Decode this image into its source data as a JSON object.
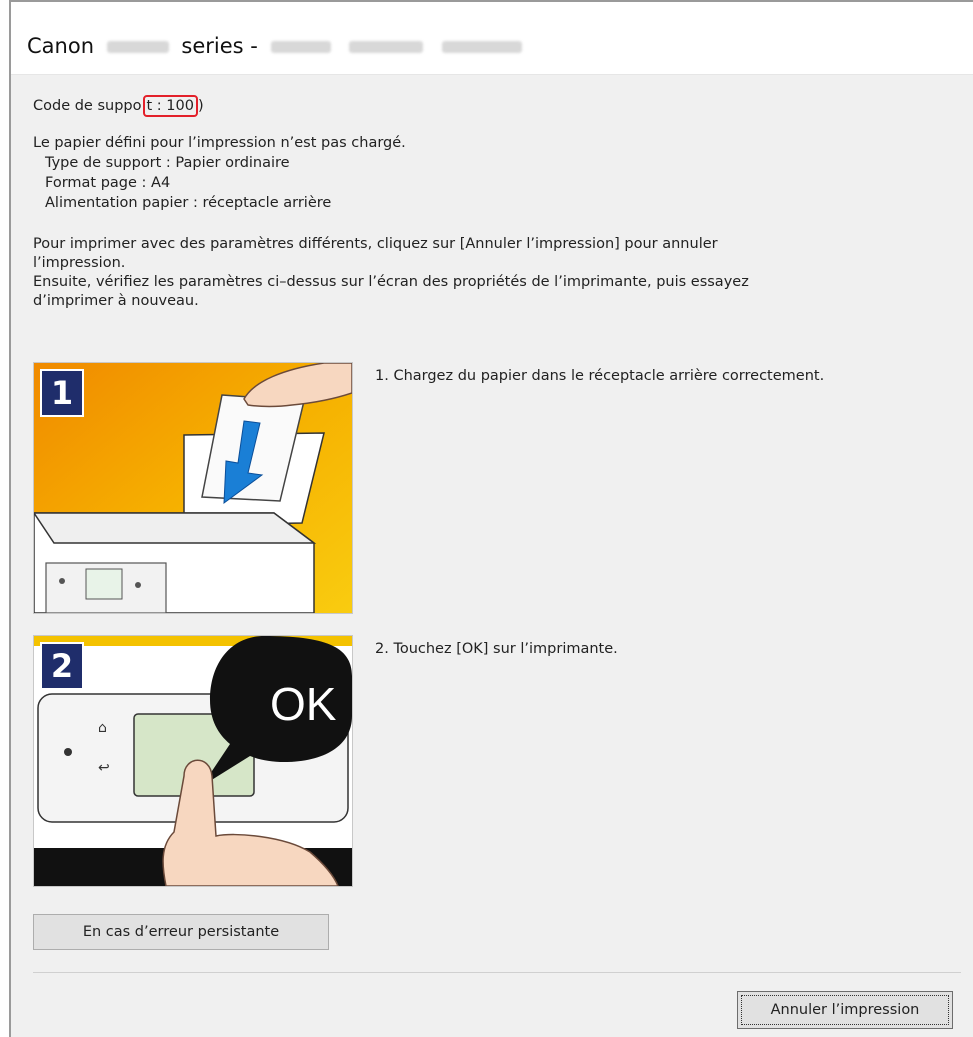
{
  "window": {
    "title_prefix": "Canon",
    "title_middle": "series -"
  },
  "support": {
    "label_before": "Code de suppo",
    "code_boxed": "t : 100",
    "label_after": ")"
  },
  "message": {
    "line1": "Le papier défini pour l’impression n’est pas chargé.",
    "media_type": "Type de support : Papier ordinaire",
    "page_size": "Format page : A4",
    "paper_source": "Alimentation papier : réceptacle arrière",
    "instr1": "Pour imprimer avec des paramètres différents, cliquez sur [Annuler l’impression] pour annuler",
    "instr2": "l’impression.",
    "instr3": "Ensuite, vérifiez les paramètres ci–dessus sur l’écran des propriétés de l’imprimante, puis essayez",
    "instr4": "d’imprimer à nouveau."
  },
  "steps": [
    {
      "badge": "1",
      "text": "1.  Chargez du papier dans le réceptacle arrière correctement."
    },
    {
      "badge": "2",
      "text": "2.  Touchez [OK] sur l’imprimante.",
      "bubble": "OK"
    }
  ],
  "buttons": {
    "persistent_error": "En cas d’erreur persistante",
    "cancel_print": "Annuler l’impression"
  }
}
